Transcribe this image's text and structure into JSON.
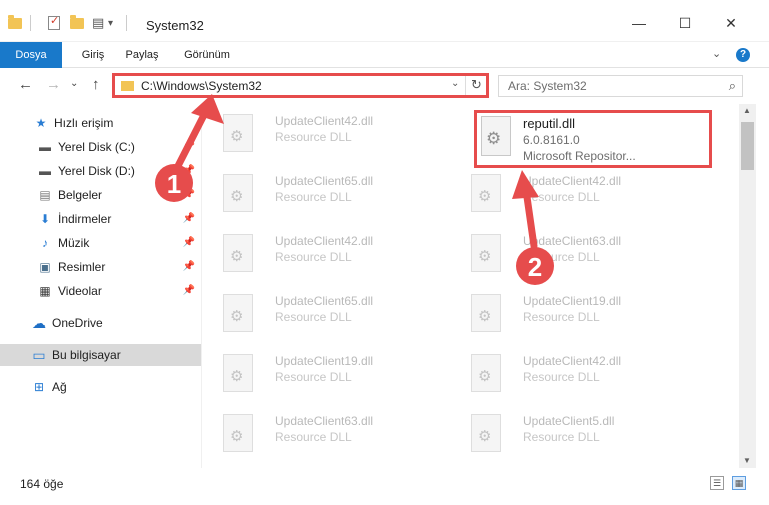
{
  "window": {
    "title": "System32",
    "minimize_glyph": "—",
    "maximize_glyph": "☐",
    "close_glyph": "✕"
  },
  "quick_access_toolbar": {
    "items": [
      "folder-icon",
      "properties-icon",
      "new-folder-icon",
      "customize-icon"
    ],
    "dropdown_glyph": "▾",
    "customize_glyph": "▤"
  },
  "ribbon": {
    "tabs": [
      "Dosya",
      "Giriş",
      "Paylaş",
      "Görünüm"
    ],
    "active_tab": "Dosya",
    "expand_glyph": "⌄",
    "help_glyph": "?"
  },
  "navigation": {
    "back_glyph": "←",
    "forward_glyph": "→",
    "recent_glyph": "⌄",
    "up_glyph": "↑"
  },
  "address_bar": {
    "path": "C:\\Windows\\System32",
    "dropdown_glyph": "⌄",
    "refresh_glyph": "↻"
  },
  "search": {
    "placeholder": "Ara: System32",
    "icon_glyph": "⌕"
  },
  "sidebar": {
    "items": [
      {
        "label": "Hızlı erişim",
        "icon": "star-icon",
        "glyph": "★",
        "pinned": false
      },
      {
        "label": "Yerel Disk (C:)",
        "icon": "drive-icon",
        "glyph": "▬",
        "pinned": true
      },
      {
        "label": "Yerel Disk (D:)",
        "icon": "drive-icon",
        "glyph": "▬",
        "pinned": true
      },
      {
        "label": "Belgeler",
        "icon": "documents-icon",
        "glyph": "▤",
        "pinned": true
      },
      {
        "label": "İndirmeler",
        "icon": "download-icon",
        "glyph": "⬇",
        "pinned": true
      },
      {
        "label": "Müzik",
        "icon": "music-icon",
        "glyph": "♪",
        "pinned": true
      },
      {
        "label": "Resimler",
        "icon": "pictures-icon",
        "glyph": "▣",
        "pinned": true
      },
      {
        "label": "Videolar",
        "icon": "videos-icon",
        "glyph": "▦",
        "pinned": true
      },
      {
        "label": "OneDrive",
        "icon": "cloud-icon",
        "glyph": "☁",
        "pinned": false
      },
      {
        "label": "Bu bilgisayar",
        "icon": "computer-icon",
        "glyph": "▭",
        "pinned": false,
        "selected": true
      },
      {
        "label": "Ağ",
        "icon": "network-icon",
        "glyph": "⊞",
        "pinned": false
      }
    ],
    "pin_glyph": "📌"
  },
  "files": {
    "left_column": [
      {
        "name": "UpdateClient42.dll",
        "type": "Resource DLL"
      },
      {
        "name": "UpdateClient65.dll",
        "type": "Resource DLL"
      },
      {
        "name": "UpdateClient42.dll",
        "type": "Resource DLL"
      },
      {
        "name": "UpdateClient65.dll",
        "type": "Resource DLL"
      },
      {
        "name": "UpdateClient19.dll",
        "type": "Resource DLL"
      },
      {
        "name": "UpdateClient63.dll",
        "type": "Resource DLL"
      }
    ],
    "right_column": [
      {
        "name": "UpdateClient42.dll",
        "type": "Resource DLL"
      },
      {
        "name": "UpdateClient63.dll",
        "type": "Resource DLL"
      },
      {
        "name": "UpdateClient19.dll",
        "type": "Resource DLL"
      },
      {
        "name": "UpdateClient42.dll",
        "type": "Resource DLL"
      },
      {
        "name": "UpdateClient5.dll",
        "type": "Resource DLL"
      }
    ],
    "highlighted": {
      "name": "reputil.dll",
      "version": "6.0.8161.0",
      "company": "Microsoft Repositor..."
    }
  },
  "status_bar": {
    "item_count": "164 öğe",
    "details_view_glyph": "☰",
    "tiles_view_glyph": "▦"
  },
  "annotations": {
    "badge_1": "1",
    "badge_2": "2",
    "color": "#e64c4c"
  },
  "colors": {
    "accent": "#1979ca",
    "annotation_red": "#e64c4c",
    "folder_yellow": "#f2c455",
    "selection_gray": "#d9d9d9"
  }
}
